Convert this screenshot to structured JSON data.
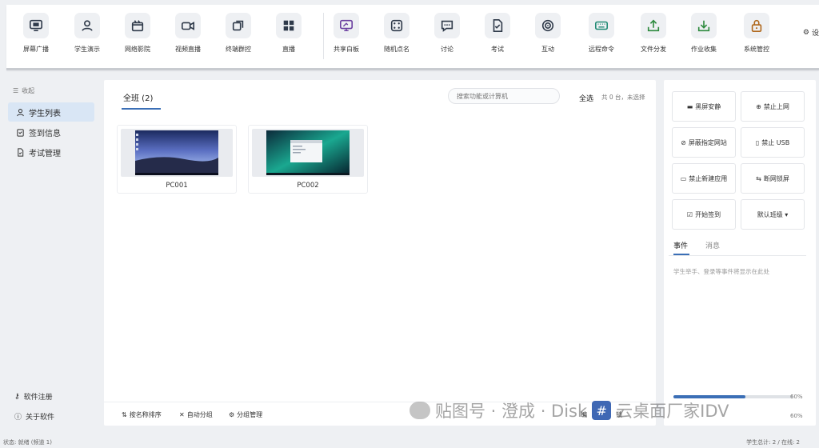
{
  "toolbar": {
    "items": [
      {
        "label": "屏幕广播",
        "icon": "monitor-icon"
      },
      {
        "label": "学生演示",
        "icon": "user-icon"
      },
      {
        "label": "网络影院",
        "icon": "clapperboard-icon"
      },
      {
        "label": "视频直播",
        "icon": "video-camera-icon"
      },
      {
        "label": "终端群控",
        "icon": "multi-window-icon"
      },
      {
        "label": "直播",
        "icon": "grid-icon"
      },
      {
        "label": "共享白板",
        "icon": "whiteboard-icon"
      },
      {
        "label": "随机点名",
        "icon": "dice-icon"
      },
      {
        "label": "讨论",
        "icon": "chat-bubble-icon"
      },
      {
        "label": "考试",
        "icon": "exam-doc-icon"
      },
      {
        "label": "互动",
        "icon": "target-icon"
      },
      {
        "label": "远程命令",
        "icon": "keyboard-icon"
      },
      {
        "label": "文件分发",
        "icon": "upload-icon"
      },
      {
        "label": "作业收集",
        "icon": "download-icon"
      },
      {
        "label": "系统管控",
        "icon": "lock-icon"
      }
    ],
    "settings_label": "设"
  },
  "sidebar": {
    "collapse_label": "收起",
    "items": [
      {
        "label": "学生列表",
        "active": true
      },
      {
        "label": "签到信息",
        "active": false
      },
      {
        "label": "考试管理",
        "active": false
      }
    ],
    "register_label": "软件注册",
    "about_label": "关于软件"
  },
  "main": {
    "tab_label": "全班 (2)",
    "search_placeholder": "搜索功能或计算机",
    "select_all_label": "全选",
    "select_info": "共 0 台，未选择",
    "computers": [
      {
        "name": "PC001"
      },
      {
        "name": "PC002"
      }
    ],
    "bottom": {
      "sort_label": "按名称排序",
      "auto_group_label": "自动分组",
      "group_manage_label": "分组管理",
      "partial_1": "编",
      "partial_2": "锁"
    }
  },
  "controls": [
    {
      "label": "黑屏安静",
      "icon": "screen-dark-icon"
    },
    {
      "label": "禁止上网",
      "icon": "globe-icon"
    },
    {
      "label": "屏蔽指定网站",
      "icon": "block-icon"
    },
    {
      "label": "禁止 USB",
      "icon": "usb-icon"
    },
    {
      "label": "禁止新建应用",
      "icon": "app-window-icon"
    },
    {
      "label": "断网锁屏",
      "icon": "link-break-icon"
    },
    {
      "label": "开始签到",
      "icon": "clipboard-check-icon"
    },
    {
      "label": "默认班级 ▾",
      "icon": ""
    }
  ],
  "events": {
    "tabs": [
      {
        "label": "事件",
        "active": true
      },
      {
        "label": "消息",
        "active": false
      }
    ],
    "empty_text": "学生举手、登录等事件将显示在此处"
  },
  "volume": {
    "level": 0.6,
    "label": "60%",
    "label2": "60%"
  },
  "status": {
    "left": "状态: 就绪 (频道 1)",
    "right": "学生总计: 2 / 在线: 2"
  },
  "watermark": {
    "prefix": "贴图号 · 澄成 · Disk",
    "hash": "#",
    "suffix": "云桌面厂家IDV"
  },
  "colors": {
    "accent": "#3b6fb6",
    "active_bg": "#d9e6f5",
    "background": "#eef0f3"
  }
}
